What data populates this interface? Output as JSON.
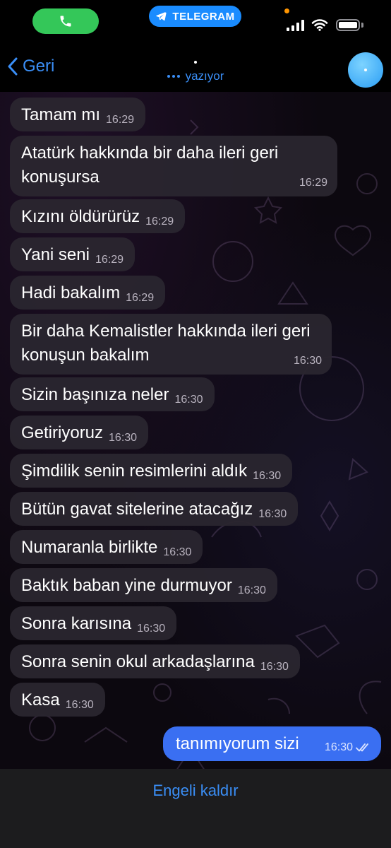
{
  "status_bar": {
    "app_pill": "TELEGRAM",
    "call_icon": "phone-icon",
    "telegram_icon": "paper-plane-icon",
    "colors": {
      "call": "#34c759",
      "app_pill": "#1a8cff",
      "privacy_dot": "#ff9500"
    }
  },
  "nav": {
    "back_label": "Geri",
    "status": "yazıyor",
    "accent": "#3a8ef6"
  },
  "messages": [
    {
      "text": "Tamam mı",
      "time": "16:29",
      "direction": "incoming"
    },
    {
      "text": "Atatürk hakkında bir daha ileri geri konuşursa",
      "time": "16:29",
      "direction": "incoming"
    },
    {
      "text": "Kızını öldürürüz",
      "time": "16:29",
      "direction": "incoming"
    },
    {
      "text": "Yani seni",
      "time": "16:29",
      "direction": "incoming"
    },
    {
      "text": "Hadi bakalım",
      "time": "16:29",
      "direction": "incoming"
    },
    {
      "text": "Bir daha Kemalistler hakkında ileri geri konuşun bakalım",
      "time": "16:30",
      "direction": "incoming"
    },
    {
      "text": "Sizin başınıza neler",
      "time": "16:30",
      "direction": "incoming"
    },
    {
      "text": "Getiriyoruz",
      "time": "16:30",
      "direction": "incoming"
    },
    {
      "text": "Şimdilik senin resimlerini aldık",
      "time": "16:30",
      "direction": "incoming"
    },
    {
      "text": "Bütün gavat sitelerine atacağız",
      "time": "16:30",
      "direction": "incoming"
    },
    {
      "text": "Numaranla birlikte",
      "time": "16:30",
      "direction": "incoming"
    },
    {
      "text": "Baktık baban yine durmuyor",
      "time": "16:30",
      "direction": "incoming"
    },
    {
      "text": "Sonra karısına",
      "time": "16:30",
      "direction": "incoming"
    },
    {
      "text": "Sonra senin okul arkadaşlarına",
      "time": "16:30",
      "direction": "incoming"
    },
    {
      "text": "Kasa",
      "time": "16:30",
      "direction": "incoming"
    },
    {
      "text": "tanımıyorum sizi",
      "time": "16:30",
      "direction": "outgoing",
      "status": "read"
    }
  ],
  "bottom": {
    "unblock_label": "Engeli kaldır"
  }
}
